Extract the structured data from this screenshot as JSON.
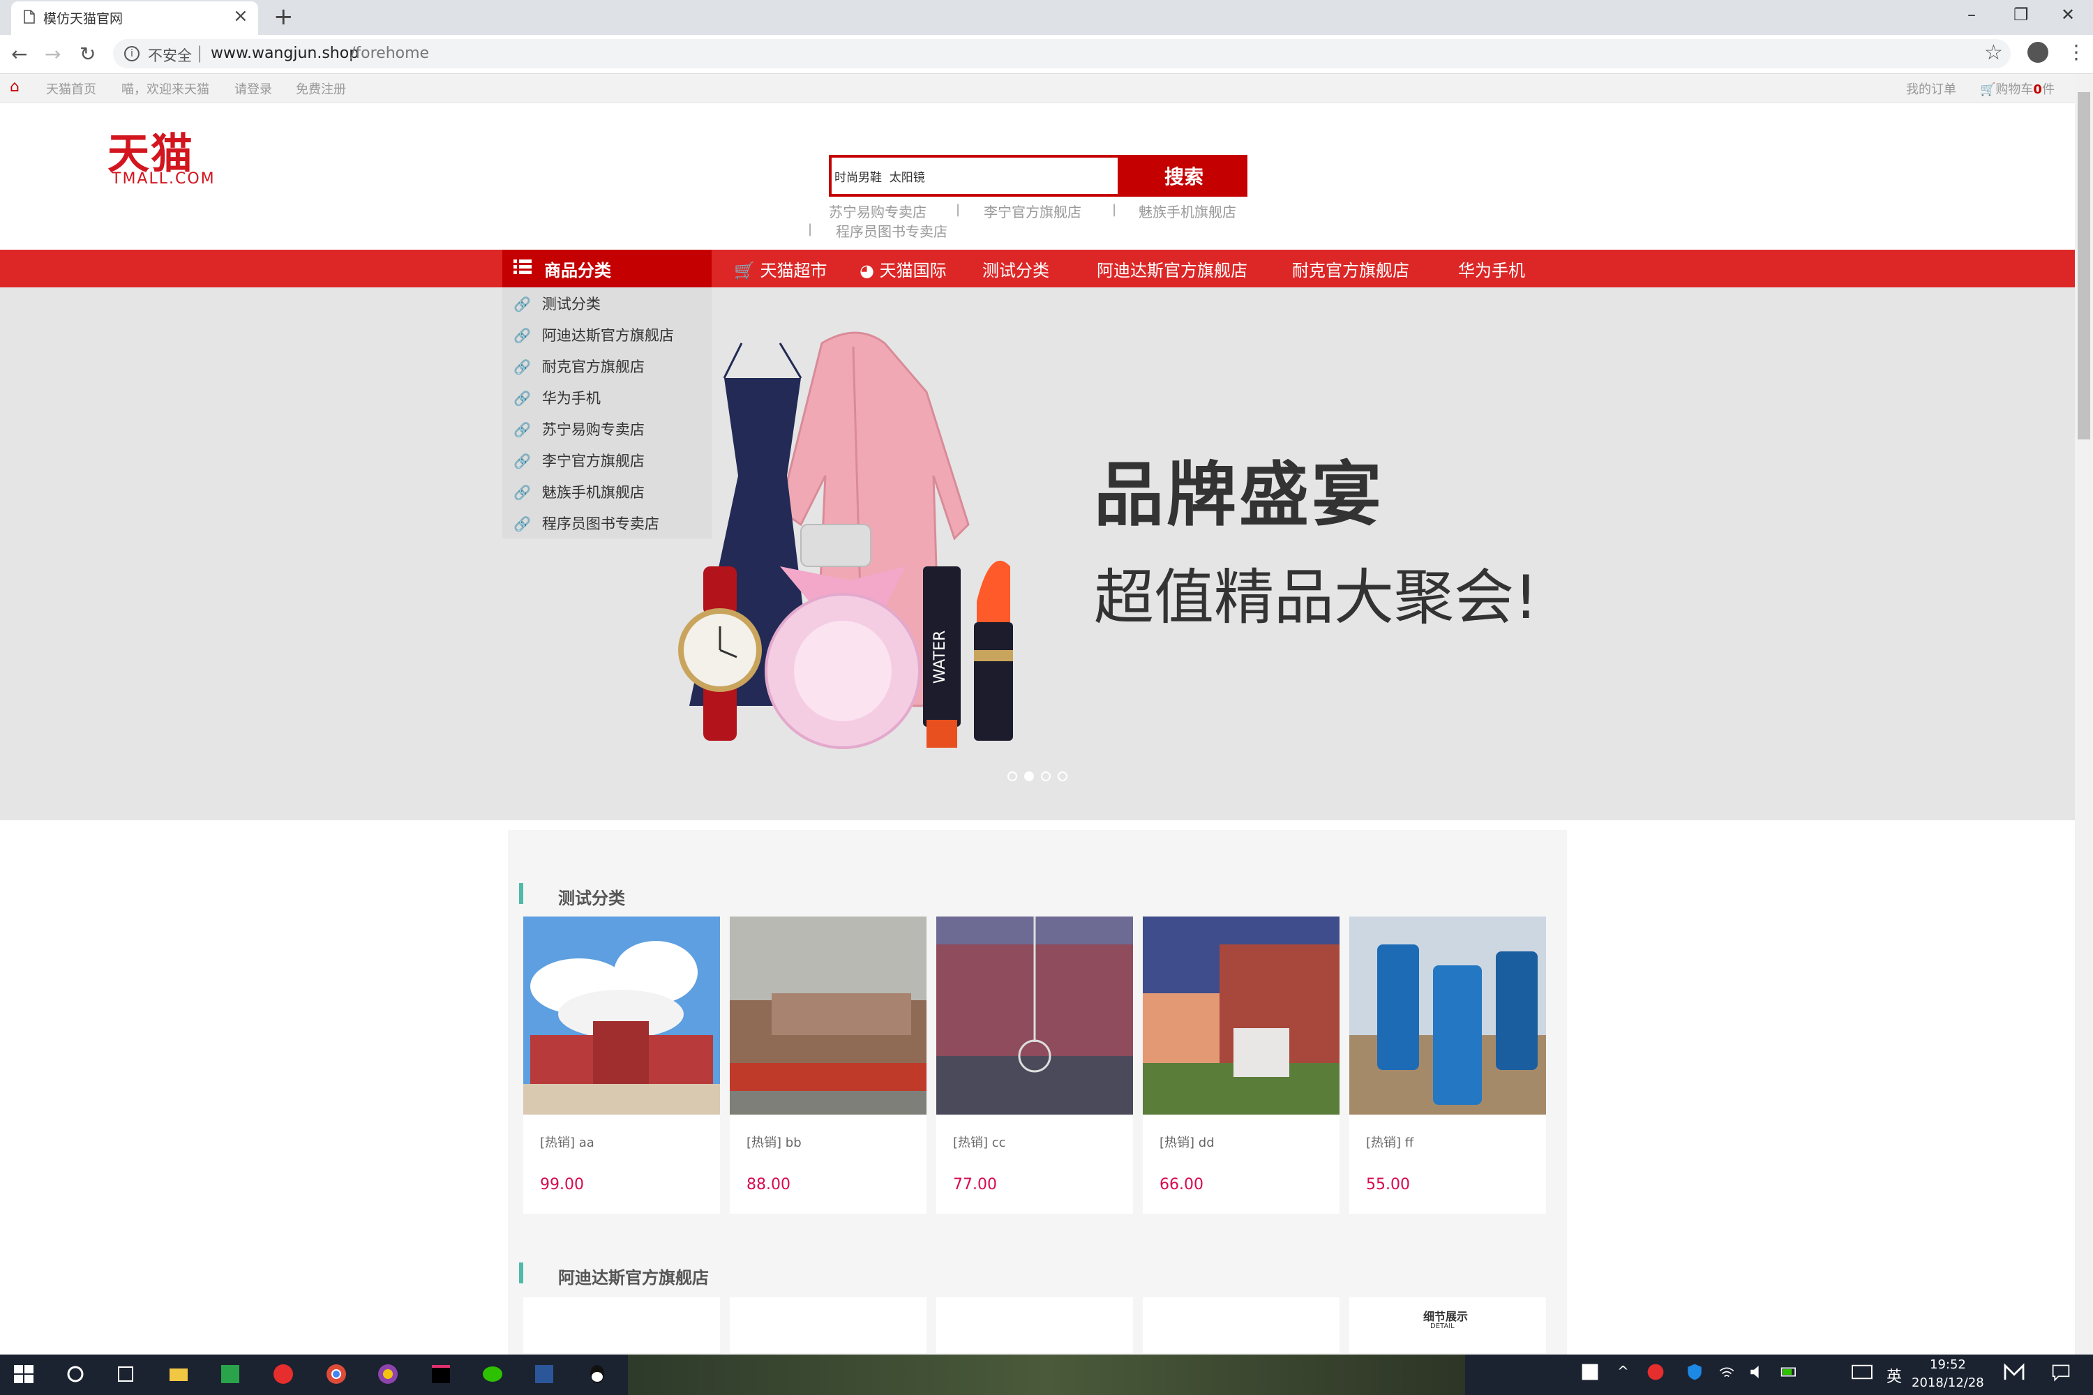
{
  "browser": {
    "tab_title": "模仿天猫官网",
    "close_glyph": "×",
    "newtab_glyph": "+",
    "win_min": "–",
    "win_max": "❐",
    "win_close": "✕",
    "back": "←",
    "forward": "→",
    "reload": "↻",
    "security_label": "不安全",
    "url_separator": "|",
    "url_host": "www.wangjun.shop",
    "url_path": "/forehome",
    "star": "☆",
    "menu": "⋮"
  },
  "topbar": {
    "home": "天猫首页",
    "welcome": "喵，欢迎来天猫",
    "login": "请登录",
    "register": "免费注册",
    "orders": "我的订单",
    "cart_prefix": "购物车",
    "cart_count": "0",
    "cart_suffix": "件"
  },
  "logo": {
    "cn": "天猫",
    "en": "TMALL.COM"
  },
  "search": {
    "value": "时尚男鞋  太阳镜",
    "button": "搜索",
    "hot_links": [
      "苏宁易购专卖店",
      "李宁官方旗舰店",
      "魅族手机旗舰店",
      "程序员图书专卖店"
    ],
    "separator": "|"
  },
  "catnav": {
    "head": "商品分类",
    "items": [
      "天猫超市",
      "天猫国际",
      "测试分类",
      "阿迪达斯官方旗舰店",
      "耐克官方旗舰店",
      "华为手机"
    ]
  },
  "category_list": [
    "测试分类",
    "阿迪达斯官方旗舰店",
    "耐克官方旗舰店",
    "华为手机",
    "苏宁易购专卖店",
    "李宁官方旗舰店",
    "魅族手机旗舰店",
    "程序员图书专卖店"
  ],
  "banner": {
    "title": "品牌盛宴",
    "subtitle": "超值精品大聚会!",
    "bottle_text": "WATER",
    "active_dot": 1
  },
  "section1": {
    "title": "测试分类",
    "products": [
      {
        "name": "[热销] aa",
        "price": "99.00"
      },
      {
        "name": "[热销] bb",
        "price": "88.00"
      },
      {
        "name": "[热销] cc",
        "price": "77.00"
      },
      {
        "name": "[热销] dd",
        "price": "66.00"
      },
      {
        "name": "[热销] ff",
        "price": "55.00"
      }
    ]
  },
  "section2": {
    "title": "阿迪达斯官方旗舰店",
    "detail_title": "细节展示",
    "detail_sub": "DETAIL"
  },
  "taskbar": {
    "ime": "英",
    "time": "19:52",
    "date": "2018/12/28"
  },
  "colors": {
    "brand_red": "#dd2727",
    "dark_red": "#c40000",
    "price": "#d70b4f",
    "accent": "#4fbaa7"
  }
}
